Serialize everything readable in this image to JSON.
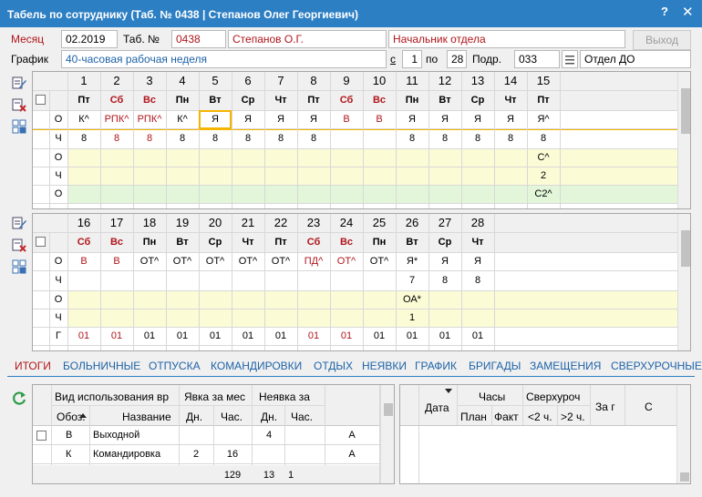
{
  "window": {
    "title": "Табель по сотруднику (Таб. № 0438 | Степанов Олег Георгиевич)",
    "help": "?",
    "close": "✕"
  },
  "header": {
    "month_label": "Месяц",
    "month_value": "02.2019",
    "tab_label": "Таб. №",
    "tab_value": "0438",
    "employee": "Степанов О.Г.",
    "position": "Начальник отдела",
    "exit_button": "Выход",
    "schedule_label": "График",
    "schedule_value": "40-часовая рабочая неделя",
    "from_label": "с",
    "from_value": "1",
    "to_label": "по",
    "to_value": "28",
    "dept_label": "Подр.",
    "dept_code": "033",
    "dept_name": "Отдел ДО"
  },
  "grid1": {
    "days": [
      "1",
      "2",
      "3",
      "4",
      "5",
      "6",
      "7",
      "8",
      "9",
      "10",
      "11",
      "12",
      "13",
      "14",
      "15"
    ],
    "weekdays": [
      "Пт",
      "Сб",
      "Вс",
      "Пн",
      "Вт",
      "Ср",
      "Чт",
      "Пт",
      "Сб",
      "Вс",
      "Пн",
      "Вт",
      "Ср",
      "Чт",
      "Пт"
    ],
    "weekend": [
      false,
      true,
      true,
      false,
      false,
      false,
      false,
      false,
      true,
      true,
      false,
      false,
      false,
      false,
      false
    ],
    "row_labels": [
      "О",
      "Ч",
      "О",
      "Ч",
      "О"
    ],
    "codes": [
      "К^",
      "РПК^",
      "РПК^",
      "К^",
      "Я",
      "Я",
      "Я",
      "Я",
      "В",
      "В",
      "Я",
      "Я",
      "Я",
      "Я",
      "Я^"
    ],
    "codes_red": [
      false,
      true,
      true,
      false,
      false,
      false,
      false,
      false,
      true,
      true,
      false,
      false,
      false,
      false,
      false
    ],
    "hours": [
      "8",
      "8",
      "8",
      "8",
      "8",
      "8",
      "8",
      "8",
      "",
      "",
      "8",
      "8",
      "8",
      "8",
      "8"
    ],
    "extra_o1": [
      "",
      "",
      "",
      "",
      "",
      "",
      "",
      "",
      "",
      "",
      "",
      "",
      "",
      "",
      "С^"
    ],
    "extra_h": [
      "",
      "",
      "",
      "",
      "",
      "",
      "",
      "",
      "",
      "",
      "",
      "",
      "",
      "",
      "2"
    ],
    "extra_o2": [
      "",
      "",
      "",
      "",
      "",
      "",
      "",
      "",
      "",
      "",
      "",
      "",
      "",
      "",
      "С2^"
    ]
  },
  "grid2": {
    "days": [
      "16",
      "17",
      "18",
      "19",
      "20",
      "21",
      "22",
      "23",
      "24",
      "25",
      "26",
      "27",
      "28"
    ],
    "weekdays": [
      "Сб",
      "Вс",
      "Пн",
      "Вт",
      "Ср",
      "Чт",
      "Пт",
      "Сб",
      "Вс",
      "Пн",
      "Вт",
      "Ср",
      "Чт"
    ],
    "weekend": [
      true,
      true,
      false,
      false,
      false,
      false,
      false,
      true,
      true,
      false,
      false,
      false,
      false
    ],
    "row_labels": [
      "О",
      "Ч",
      "О",
      "Ч",
      "Г"
    ],
    "codes": [
      "В",
      "В",
      "ОТ^",
      "ОТ^",
      "ОТ^",
      "ОТ^",
      "ОТ^",
      "ПД^",
      "ОТ^",
      "ОТ^",
      "Я*",
      "Я",
      "Я"
    ],
    "codes_red": [
      true,
      true,
      false,
      false,
      false,
      false,
      false,
      true,
      true,
      false,
      false,
      false,
      false
    ],
    "hours": [
      "",
      "",
      "",
      "",
      "",
      "",
      "",
      "",
      "",
      "",
      "7",
      "8",
      "8"
    ],
    "extra_o1": [
      "",
      "",
      "",
      "",
      "",
      "",
      "",
      "",
      "",
      "",
      "ОА*",
      "",
      ""
    ],
    "extra_h": [
      "",
      "",
      "",
      "",
      "",
      "",
      "",
      "",
      "",
      "",
      "1",
      "",
      ""
    ],
    "g_row": [
      "01",
      "01",
      "01",
      "01",
      "01",
      "01",
      "01",
      "01",
      "01",
      "01",
      "01",
      "01",
      "01"
    ],
    "g_red": [
      true,
      true,
      false,
      false,
      false,
      false,
      false,
      true,
      true,
      false,
      false,
      false,
      false
    ]
  },
  "tabs": [
    "ИТОГИ",
    "БОЛЬНИЧНЫЕ",
    "ОТПУСКА",
    "КОМАНДИРОВКИ",
    "ОТДЫХ",
    "НЕЯВКИ",
    "ГРАФИК",
    "БРИГАДЫ",
    "ЗАМЕЩЕНИЯ",
    "СВЕРХУРОЧНЫЕ"
  ],
  "summary": {
    "h_usage": "Вид использования вр",
    "h_attend": "Явка за мес",
    "h_absent": "Неявка за",
    "h_code": "Обоз.",
    "h_name": "Название",
    "h_days": "Дн.",
    "h_hours": "Час.",
    "h_days2": "Дн.",
    "h_hours2": "Час.",
    "rows": [
      {
        "code": "В",
        "name": "Выходной",
        "d1": "",
        "h1": "",
        "d2": "4",
        "h2": "",
        "flag": "А"
      },
      {
        "code": "К",
        "name": "Командировка",
        "d1": "2",
        "h1": "16",
        "d2": "",
        "h2": "",
        "flag": "А"
      }
    ],
    "totals": {
      "h1": "129",
      "d2": "13",
      "h2": "1"
    }
  },
  "overtime": {
    "h_date": "Дата",
    "h_hours": "Часы",
    "h_plan": "План",
    "h_fact": "Факт",
    "h_over": "Сверхуроч",
    "h_lt2": "<2 ч.",
    "h_gt2": ">2 ч.",
    "h_forg": "За г",
    "h_c": "С"
  }
}
